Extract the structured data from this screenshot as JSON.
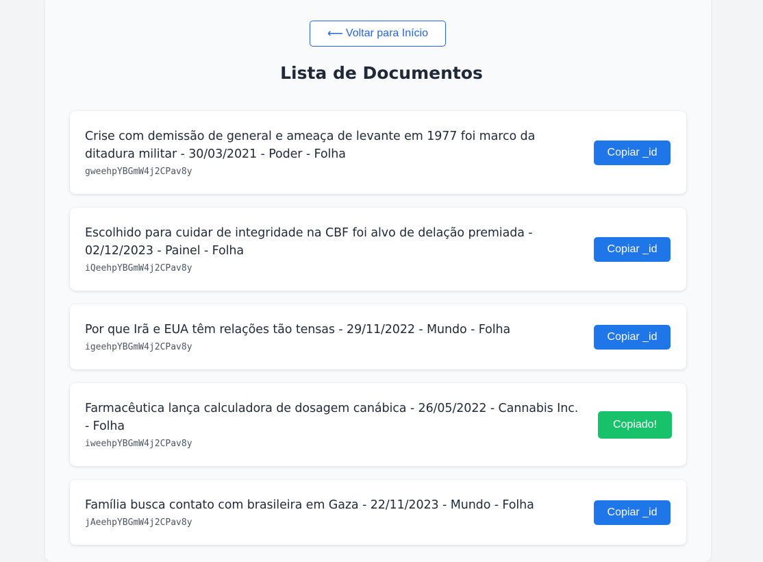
{
  "header": {
    "back_arrow": "⟵",
    "back_label": "Voltar para Início",
    "title": "Lista de Documentos"
  },
  "colors": {
    "accent": "#1f76e8",
    "success": "#17c26a",
    "text": "#1f2937",
    "id_text": "#4b5563"
  },
  "documents": [
    {
      "title": "Crise com demissão de general e ameaça de levante em 1977 foi marco da ditadura militar - 30/03/2021 - Poder - Folha",
      "id": "gweehpYBGmW4j2CPav8y",
      "button_label": "Copiar _id",
      "state": "default"
    },
    {
      "title": "Escolhido para cuidar de integridade na CBF foi alvo de delação premiada - 02/12/2023 - Painel - Folha",
      "id": "iQeehpYBGmW4j2CPav8y",
      "button_label": "Copiar _id",
      "state": "default"
    },
    {
      "title": "Por que Irã e EUA têm relações tão tensas - 29/11/2022 - Mundo - Folha",
      "id": "igeehpYBGmW4j2CPav8y",
      "button_label": "Copiar _id",
      "state": "default"
    },
    {
      "title": "Farmacêutica lança calculadora de dosagem canábica - 26/05/2022 - Cannabis Inc. - Folha",
      "id": "iweehpYBGmW4j2CPav8y",
      "button_label": "Copiado!",
      "state": "copied"
    },
    {
      "title": "Família busca contato com brasileira em Gaza - 22/11/2023 - Mundo - Folha",
      "id": "jAeehpYBGmW4j2CPav8y",
      "button_label": "Copiar _id",
      "state": "default"
    }
  ]
}
